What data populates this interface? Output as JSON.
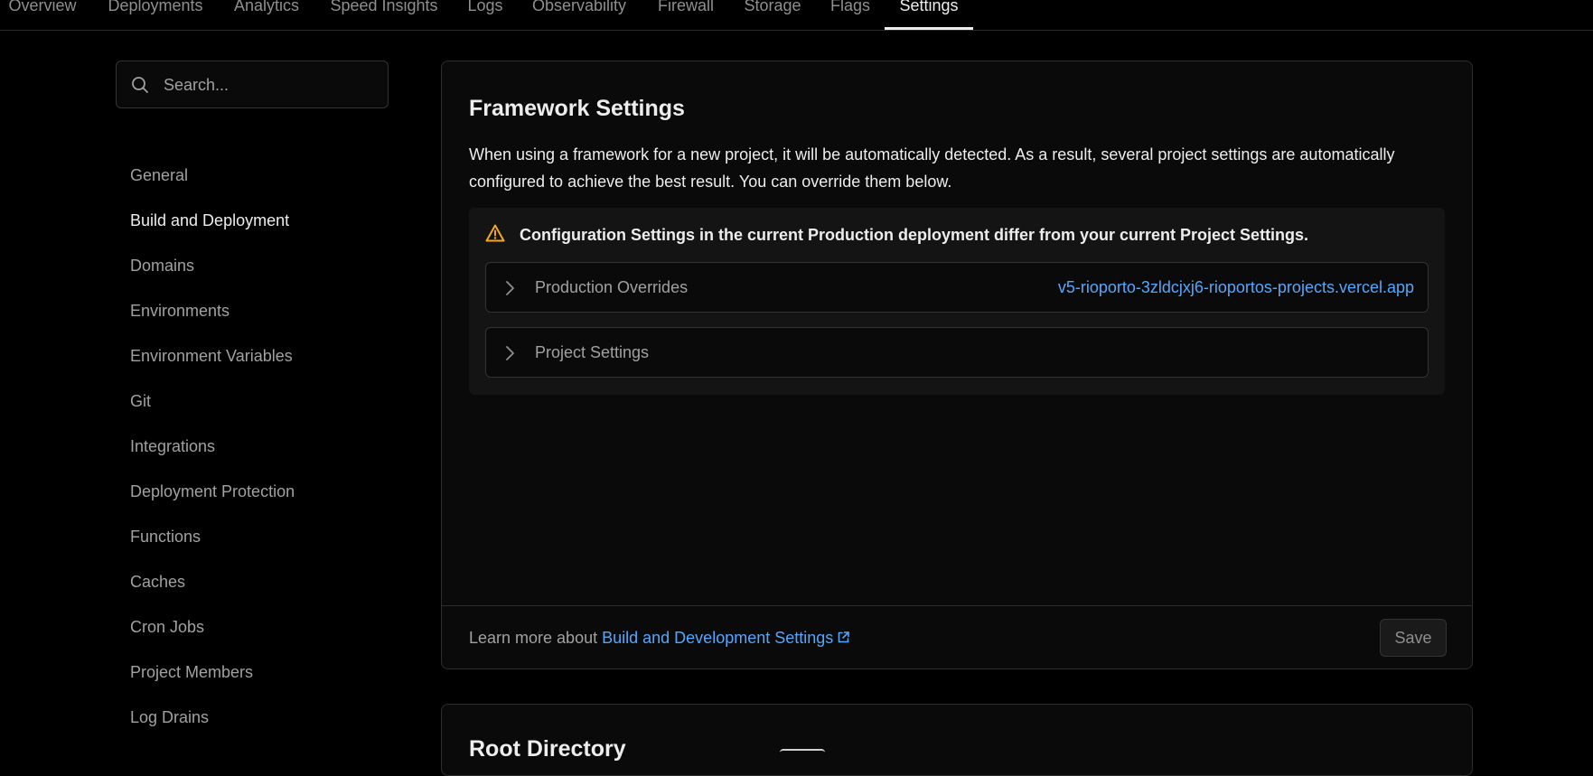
{
  "top_nav": {
    "tabs": [
      {
        "label": "Overview"
      },
      {
        "label": "Deployments"
      },
      {
        "label": "Analytics"
      },
      {
        "label": "Speed Insights"
      },
      {
        "label": "Logs"
      },
      {
        "label": "Observability"
      },
      {
        "label": "Firewall"
      },
      {
        "label": "Storage"
      },
      {
        "label": "Flags"
      },
      {
        "label": "Settings"
      }
    ],
    "active_tab": "Settings"
  },
  "sidebar": {
    "search_placeholder": "Search...",
    "items": [
      {
        "label": "General"
      },
      {
        "label": "Build and Deployment"
      },
      {
        "label": "Domains"
      },
      {
        "label": "Environments"
      },
      {
        "label": "Environment Variables"
      },
      {
        "label": "Git"
      },
      {
        "label": "Integrations"
      },
      {
        "label": "Deployment Protection"
      },
      {
        "label": "Functions"
      },
      {
        "label": "Caches"
      },
      {
        "label": "Cron Jobs"
      },
      {
        "label": "Project Members"
      },
      {
        "label": "Log Drains"
      }
    ],
    "active_item": "Build and Deployment"
  },
  "framework_settings": {
    "title": "Framework Settings",
    "description": "When using a framework for a new project, it will be automatically detected. As a result, several project settings are automatically configured to achieve the best result. You can override them below.",
    "warning": {
      "icon": "warning-triangle-icon",
      "text": "Configuration Settings in the current Production deployment differ from your current Project Settings."
    },
    "rows": [
      {
        "label": "Production Overrides",
        "link": "v5-rioporto-3zldcjxj6-rioportos-projects.vercel.app"
      },
      {
        "label": "Project Settings"
      }
    ],
    "footer": {
      "text_prefix": "Learn more about",
      "link_label": "Build and Development Settings",
      "save_label": "Save"
    }
  },
  "root_directory": {
    "title": "Root Directory"
  },
  "colors": {
    "background": "#000000",
    "card": "#0a0a0a",
    "link": "#52a8ff",
    "warning": "#f5a623"
  }
}
